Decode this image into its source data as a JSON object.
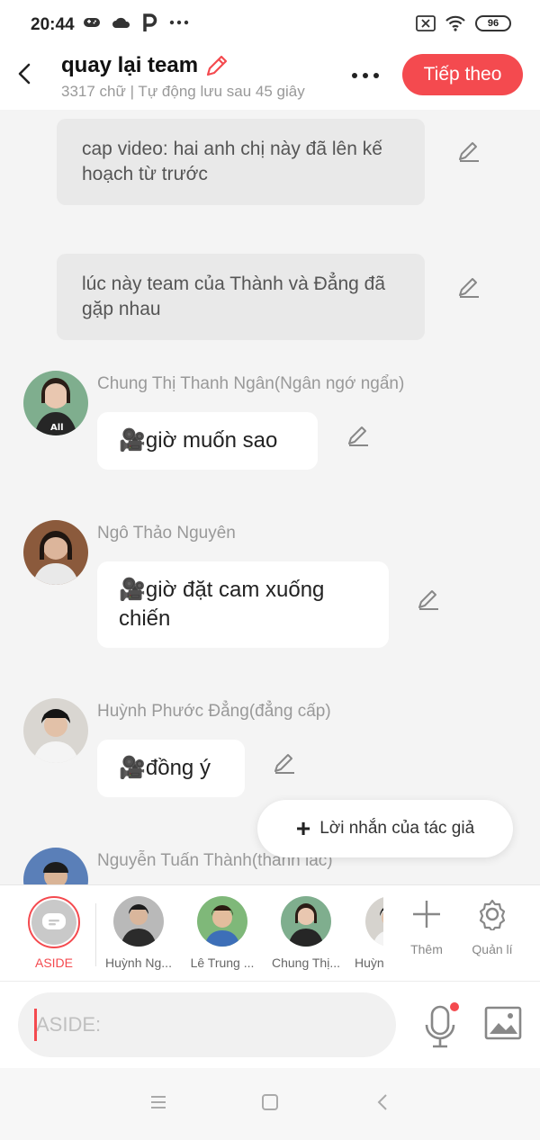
{
  "status_bar": {
    "time": "20:44",
    "battery": "96",
    "icons": [
      "gamepad-icon",
      "cloud-icon",
      "p-app-icon",
      "more-dots-icon",
      "sim-x-icon",
      "wifi-icon",
      "battery-icon"
    ]
  },
  "header": {
    "title": "quay lại team",
    "subtitle": "3317 chữ | Tự động lưu sau 45 giây",
    "next_label": "Tiếp theo",
    "accent": "#f44a4f"
  },
  "messages": {
    "narrations": [
      "cap video: hai anh chị này đã lên kế hoạch từ trước",
      "lúc này team của Thành và Đẳng đã gặp nhau"
    ],
    "dialogs": [
      {
        "name": "Chung Thị Thanh Ngân(Ngân ngớ ngẩn)",
        "text": "🎥giờ muốn sao"
      },
      {
        "name": "Ngô Thảo Nguyên",
        "text": "🎥giờ đặt cam xuống chiến"
      },
      {
        "name": "Huỳnh Phước Đẳng(đẳng cấp)",
        "text": "🎥đồng ý"
      },
      {
        "name": "Nguyễn Tuấn Thành(thành lác)"
      }
    ]
  },
  "floating": {
    "label": "Lời nhắn của tác giả"
  },
  "characters": {
    "aside_label": "ASIDE",
    "items": [
      "Huỳnh Ng...",
      "Lê Trung ...",
      "Chung Thị...",
      "Huỳn"
    ],
    "add_label": "Thêm",
    "manage_label": "Quản lí"
  },
  "input": {
    "placeholder": "ASIDE:"
  }
}
